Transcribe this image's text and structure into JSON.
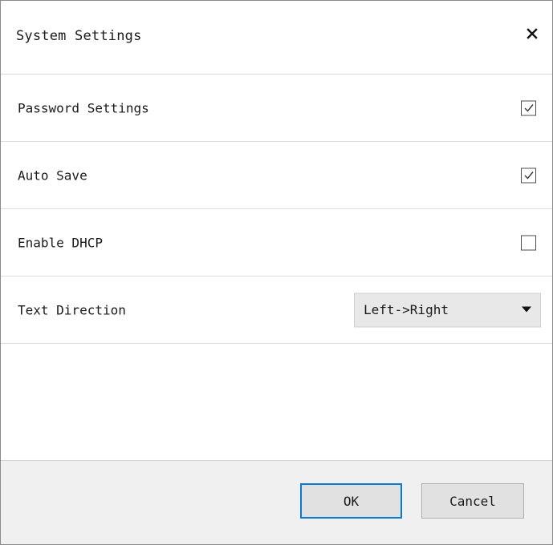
{
  "dialog": {
    "title": "System Settings",
    "close_icon": "close-icon"
  },
  "settings": [
    {
      "label": "Password Settings",
      "control": "checkbox",
      "checked": true
    },
    {
      "label": "Auto Save",
      "control": "checkbox",
      "checked": true
    },
    {
      "label": "Enable DHCP",
      "control": "checkbox",
      "checked": false
    }
  ],
  "text_direction": {
    "label": "Text Direction",
    "selected": "Left->Right",
    "icon": "chevron-down-icon"
  },
  "footer": {
    "ok_label": "OK",
    "cancel_label": "Cancel"
  },
  "colors": {
    "accent_focus": "#0a78d7",
    "footer_bg": "#f0f0f0",
    "select_bg": "#e8e8e8"
  }
}
